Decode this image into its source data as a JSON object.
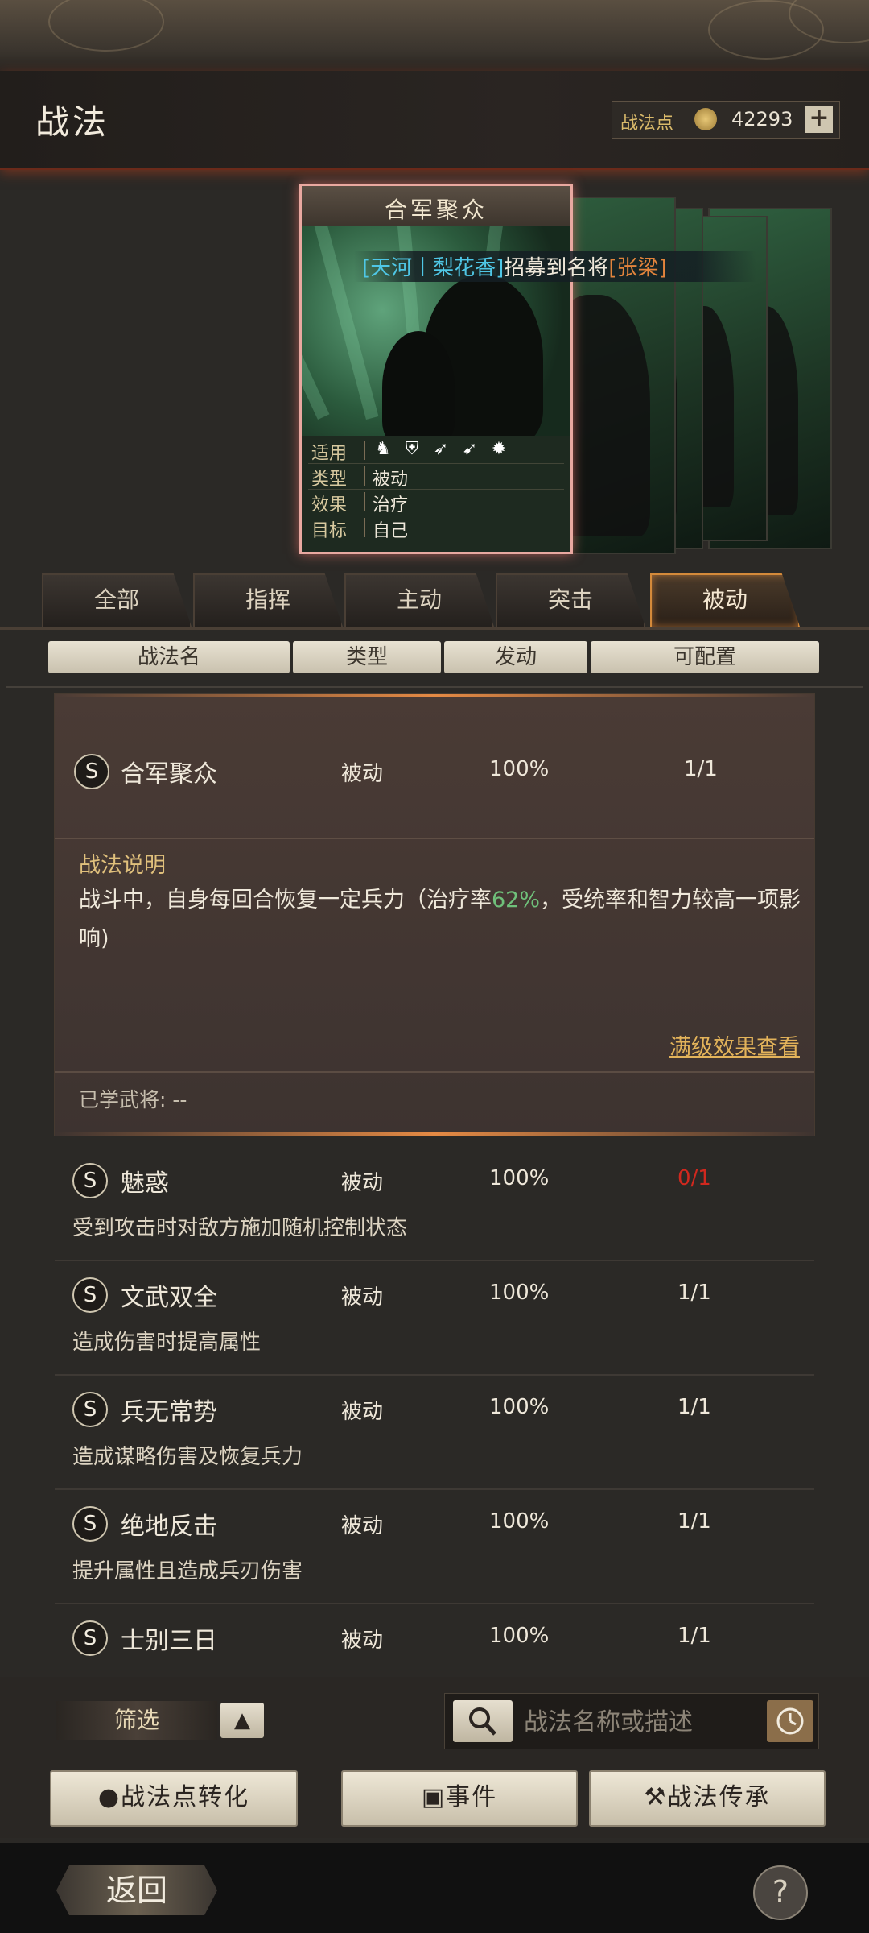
{
  "header": {
    "title": "战法",
    "points_label": "战法点",
    "points_value": "42293",
    "add_label": "+"
  },
  "card": {
    "title": "合军聚众",
    "recruit_banner": {
      "part1": "[天河丨梨花香]",
      "part2": "招募到名将",
      "part3": "[张梁]"
    },
    "info": [
      {
        "key": "适用",
        "value": ""
      },
      {
        "key": "类型",
        "value": "被动"
      },
      {
        "key": "效果",
        "value": "治疗"
      },
      {
        "key": "目标",
        "value": "自己"
      }
    ],
    "apply_icons": [
      "cavalry-icon",
      "shield-icon",
      "bow-icon",
      "spear-icon",
      "wheel-icon"
    ]
  },
  "tabs": [
    "全部",
    "指挥",
    "主动",
    "突击",
    "被动"
  ],
  "active_tab": 4,
  "columns": [
    "战法名",
    "类型",
    "发动",
    "可配置"
  ],
  "expanded": {
    "badge": "S",
    "name": "合军聚众",
    "type": "被动",
    "rate": "100%",
    "count": "1/1",
    "desc_title": "战法说明",
    "desc_before": "战斗中，自身每回合恢复一定兵力（治疗率",
    "desc_highlight": "62%",
    "desc_after": "，受统率和智力较高一项影响)",
    "max_effect_link": "满级效果查看",
    "learned": "已学武将: --"
  },
  "list": [
    {
      "badge": "S",
      "name": "魅惑",
      "type": "被动",
      "rate": "100%",
      "count": "0/1",
      "desc": "受到攻击时对敌方施加随机控制状态"
    },
    {
      "badge": "S",
      "name": "文武双全",
      "type": "被动",
      "rate": "100%",
      "count": "1/1",
      "desc": "造成伤害时提高属性"
    },
    {
      "badge": "S",
      "name": "兵无常势",
      "type": "被动",
      "rate": "100%",
      "count": "1/1",
      "desc": "造成谋略伤害及恢复兵力"
    },
    {
      "badge": "S",
      "name": "绝地反击",
      "type": "被动",
      "rate": "100%",
      "count": "1/1",
      "desc": "提升属性且造成兵刃伤害"
    },
    {
      "badge": "S",
      "name": "士别三日",
      "type": "被动",
      "rate": "100%",
      "count": "1/1",
      "desc": ""
    }
  ],
  "controls": {
    "filter_label": "筛选",
    "filter_toggle": "▲",
    "search_placeholder": "战法名称或描述",
    "convert_label": "战法点转化",
    "event_label": "事件",
    "inherit_label": "战法传承",
    "back_label": "返回",
    "help_label": "?"
  },
  "colors": {
    "accent": "#d48a3a",
    "zero_count": "#d0281e",
    "heal_rate": "#6fc07a",
    "recruit_blue": "#4fc7e6",
    "recruit_orange": "#e2843c"
  }
}
